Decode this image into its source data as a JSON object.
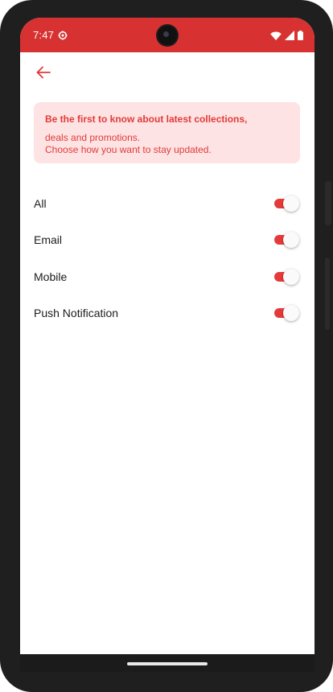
{
  "status_bar": {
    "time": "7:47",
    "gear_icon": "settings-gear-icon",
    "wifi_icon": "wifi-icon",
    "signal_icon": "cell-signal-icon",
    "battery_icon": "battery-icon",
    "background_color": "#d83131"
  },
  "header": {
    "back_icon": "arrow-left-icon",
    "accent_color": "#e23a3a"
  },
  "banner": {
    "title": "Be the first to know about latest collections,",
    "line1": "deals and promotions.",
    "line2": "Choose how you want to stay updated.",
    "background_color": "#fde3e3",
    "text_color": "#e23a3a"
  },
  "settings": {
    "items": [
      {
        "label": "All",
        "enabled": true
      },
      {
        "label": "Email",
        "enabled": true
      },
      {
        "label": "Mobile",
        "enabled": true
      },
      {
        "label": "Push Notification",
        "enabled": true
      }
    ],
    "toggle_on_color": "#e53a3a"
  }
}
